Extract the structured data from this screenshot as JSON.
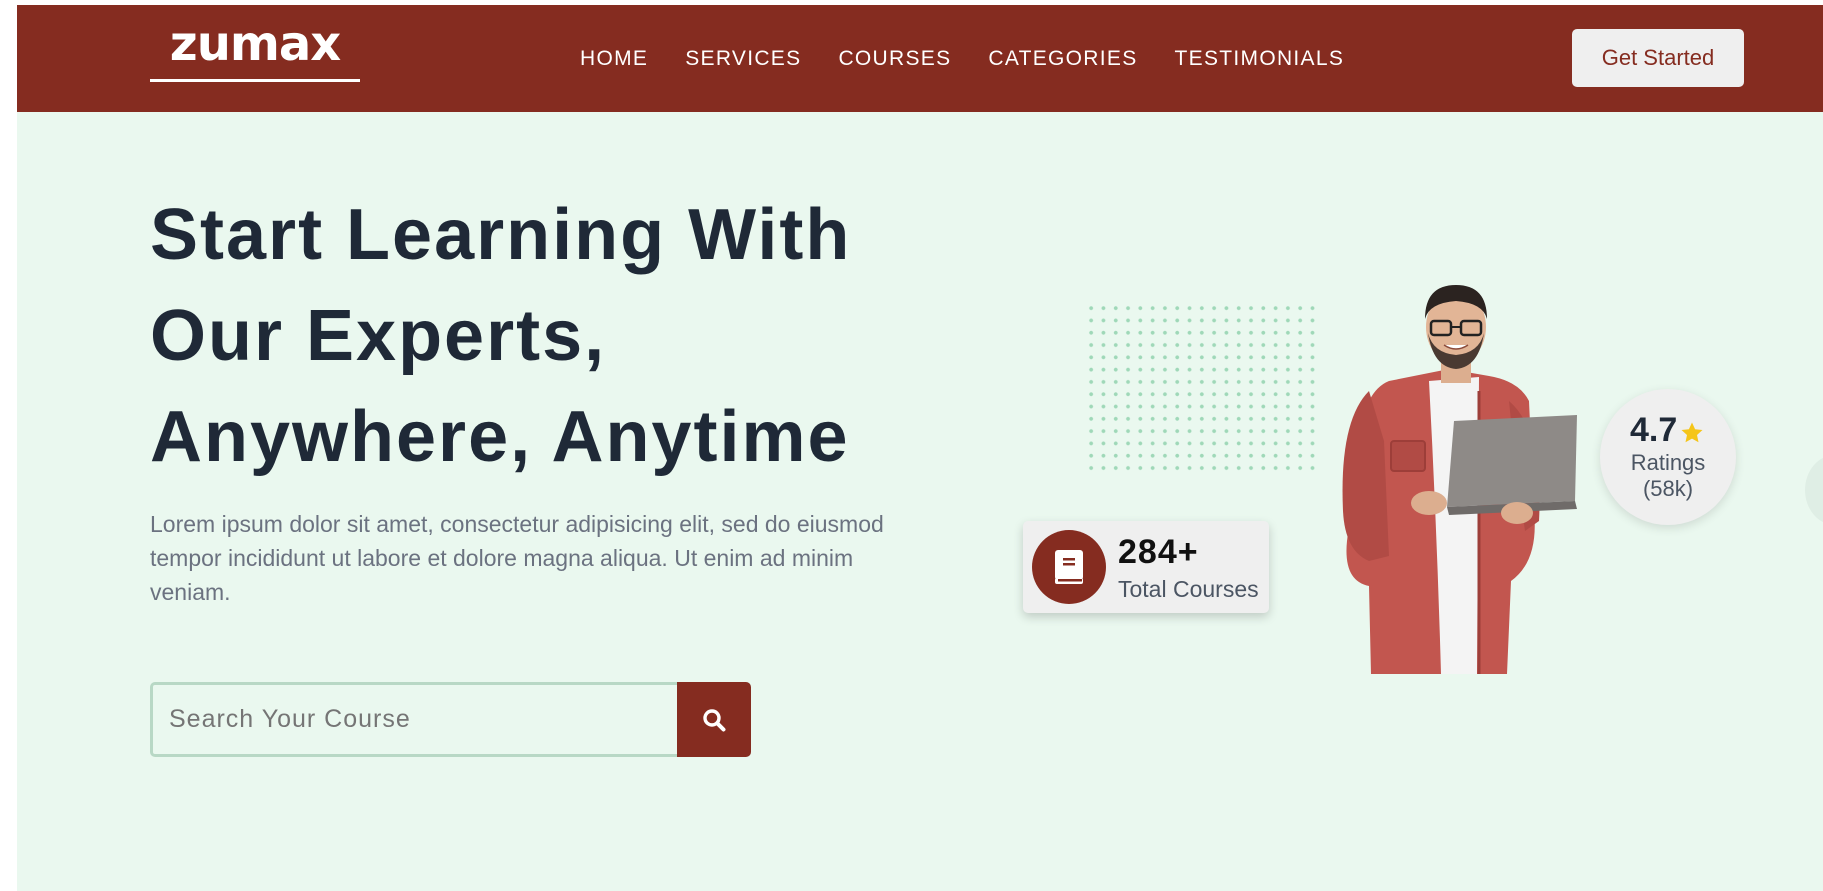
{
  "header": {
    "logo_text": "zumax",
    "nav": [
      {
        "label": "HOME"
      },
      {
        "label": "SERVICES"
      },
      {
        "label": "COURSES"
      },
      {
        "label": "CATEGORIES"
      },
      {
        "label": "TESTIMONIALS"
      }
    ],
    "cta_label": "Get Started"
  },
  "hero": {
    "title_lines": [
      "Start Learning With",
      "Our Experts,",
      "Anywhere, Anytime"
    ],
    "description": "Lorem ipsum dolor sit amet, consectetur adipisicing elit, sed do eiusmod tempor incididunt ut labore et dolore magna aliqua. Ut enim ad minim veniam.",
    "search": {
      "placeholder": "Search Your Course",
      "value": ""
    }
  },
  "stats": {
    "courses_value": "284+",
    "courses_label": "Total Courses",
    "rating_value": "4.7",
    "rating_label": "Ratings",
    "rating_count": "(58k)"
  },
  "icons": {
    "search_button": "search-icon",
    "courses_card": "book-icon",
    "rating": "star-icon"
  },
  "colors": {
    "brand": "#852c20",
    "hero_background": "#eaf8ef",
    "heading": "#1f2937",
    "star": "#f5c518"
  }
}
